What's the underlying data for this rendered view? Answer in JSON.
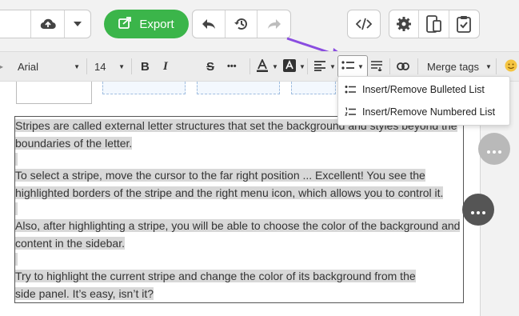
{
  "topbar": {
    "export_label": "Export"
  },
  "toolbar": {
    "font_family": "Arial",
    "font_size": "14",
    "bold": "B",
    "italic": "I",
    "strike": "S",
    "more": "•••",
    "merge_tags": "Merge tags"
  },
  "list_menu": {
    "items": [
      {
        "label": "Insert/Remove Bulleted List"
      },
      {
        "label": "Insert/Remove Numbered List"
      }
    ]
  },
  "editor": {
    "paragraphs": [
      {
        "lines": [
          "Stripes are called external letter structures that set the background and styles beyond the",
          "boundaries of the letter."
        ]
      },
      {
        "lines": [
          "To select a stripe, move the cursor to the far right position ... Excellent! You see the",
          "highlighted borders of the stripe and the right menu icon, which allows you to control it."
        ]
      },
      {
        "lines": [
          "Also, after highlighting a stripe, you will be able to choose the color of the background and",
          "content in the sidebar."
        ]
      },
      {
        "lines": [
          "Try to highlight the current stripe and change the color of its background from the",
          "side panel. It’s easy, isn’t it?"
        ]
      }
    ]
  },
  "colors": {
    "export_green": "#3bb54a",
    "arrow_purple": "#8a4de0",
    "highlight_gray": "#d8d8d8"
  }
}
